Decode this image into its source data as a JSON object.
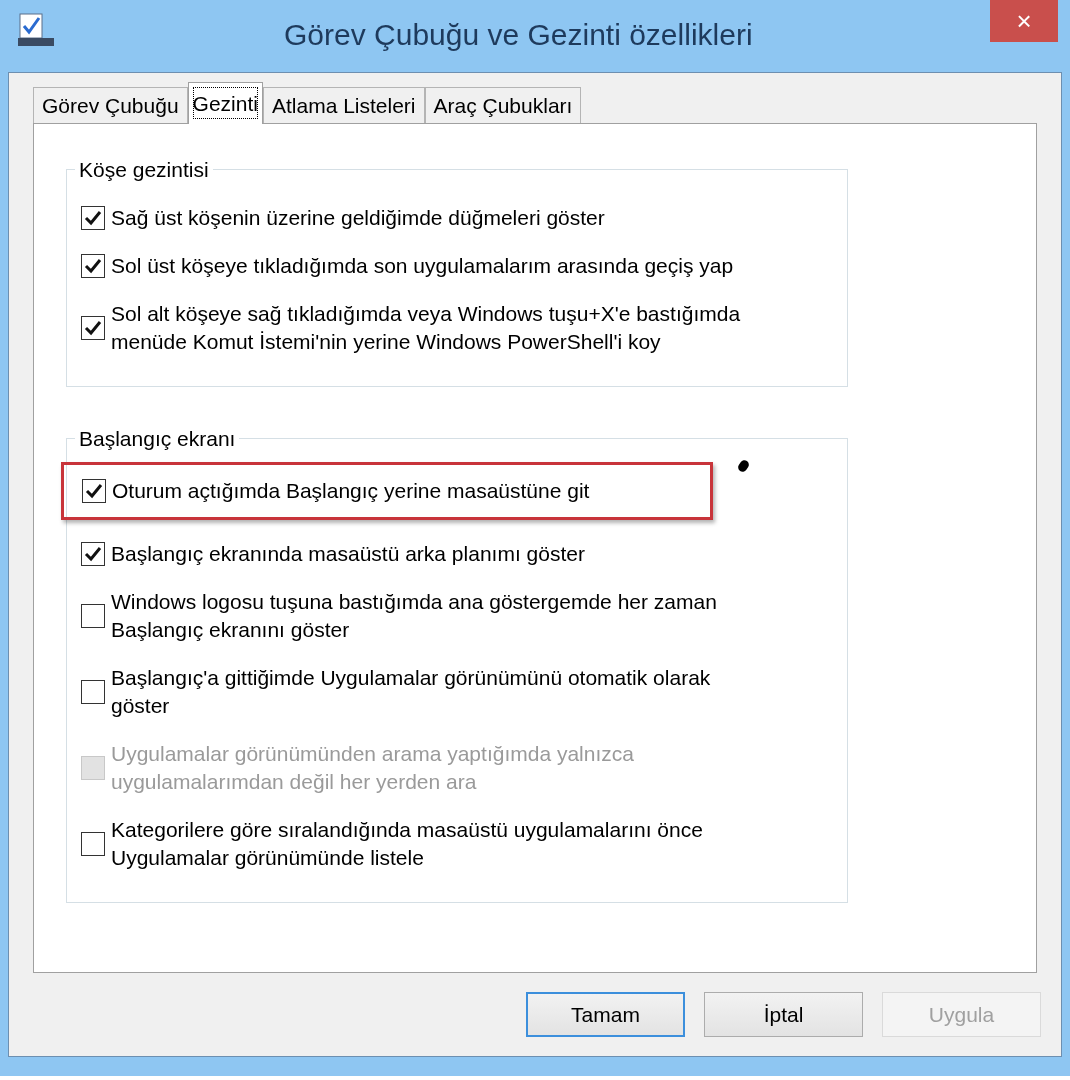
{
  "window": {
    "title": "Görev Çubuğu ve Gezinti özellikleri",
    "close": "×"
  },
  "tabs": [
    {
      "label": "Görev Çubuğu",
      "selected": false
    },
    {
      "label": "Gezinti",
      "selected": true
    },
    {
      "label": "Atlama Listeleri",
      "selected": false
    },
    {
      "label": "Araç Çubukları",
      "selected": false
    }
  ],
  "groups": [
    {
      "title": "Köşe gezintisi",
      "items": [
        {
          "label": "Sağ üst köşenin üzerine geldiğimde düğmeleri göster",
          "checked": true,
          "disabled": false,
          "highlighted": false
        },
        {
          "label": "Sol üst köşeye tıkladığımda son uygulamalarım arasında geçiş yap",
          "checked": true,
          "disabled": false,
          "highlighted": false
        },
        {
          "label": "Sol alt köşeye sağ tıkladığımda veya Windows tuşu+X'e bastığımda menüde Komut İstemi'nin yerine Windows PowerShell'i koy",
          "checked": true,
          "disabled": false,
          "highlighted": false
        }
      ]
    },
    {
      "title": "Başlangıç ekranı",
      "items": [
        {
          "label": "Oturum açtığımda Başlangıç yerine masaüstüne git",
          "checked": true,
          "disabled": false,
          "highlighted": true
        },
        {
          "label": "Başlangıç ekranında masaüstü arka planımı göster",
          "checked": true,
          "disabled": false,
          "highlighted": false
        },
        {
          "label": "Windows logosu tuşuna bastığımda ana göstergemde her zaman Başlangıç ekranını göster",
          "checked": false,
          "disabled": false,
          "highlighted": false
        },
        {
          "label": "Başlangıç'a gittiğimde Uygulamalar görünümünü otomatik olarak göster",
          "checked": false,
          "disabled": false,
          "highlighted": false
        },
        {
          "label": "Uygulamalar görünümünden arama yaptığımda yalnızca uygulamalarımdan değil her yerden ara",
          "checked": false,
          "disabled": true,
          "highlighted": false
        },
        {
          "label": "Kategorilere göre sıralandığında masaüstü uygulamalarını önce Uygulamalar görünümünde listele",
          "checked": false,
          "disabled": false,
          "highlighted": false
        }
      ]
    }
  ],
  "buttons": [
    {
      "label": "Tamam",
      "disabled": false,
      "default": true
    },
    {
      "label": "İptal",
      "disabled": false,
      "default": false
    },
    {
      "label": "Uygula",
      "disabled": true,
      "default": false
    }
  ]
}
